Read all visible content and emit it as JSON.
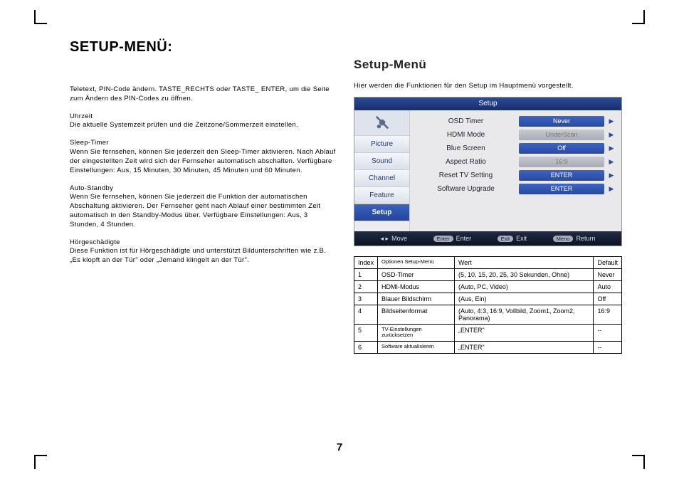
{
  "left": {
    "title": "SETUP-MENÜ:",
    "p1": "Teletext, PIN-Code ändern.\nTASTE_RECHTS oder TASTE_ ENTER, um die Seite zum Ändern des PIN-Codes zu öffnen.",
    "p2h": "Uhrzeit",
    "p2": "Die aktuelle Systemzeit prüfen und die Zeitzone/Sommerzeit einstellen.",
    "p3h": "Sleep-Timer",
    "p3": "Wenn Sie fernsehen, können Sie jederzeit den Sleep-Timer aktivieren. Nach Ablauf der eingestellten Zeit wird sich der Fernseher automatisch abschalten. Verfügbare Einstellungen: Aus, 15 Minuten, 30 Minuten, 45 Minuten und 60 Minuten.",
    "p4h": "Auto-Standby",
    "p4": "Wenn Sie fernsehen, können Sie jederzeit die Funktion der automatischen Abschaltung aktivieren. Der Fernseher geht nach Ablauf einer bestimmten Zeit automatisch in den Standby-Modus über. Verfügbare Einstellungen: Aus, 3 Stunden, 4 Stunden.",
    "p5h": "Hörgeschädigte",
    "p5": "Diese Funktion ist für Hörgeschädigte und unterstützt Bildunterschriften wie z.B. „Es klopft an der Tür\" oder „Jemand klingelt an der Tür\"."
  },
  "right": {
    "title": "Setup-Menü",
    "intro": "Hier werden die Funktionen für den Setup im Hauptmenü vorgestellt."
  },
  "osd": {
    "title": "Setup",
    "tabs": {
      "picture": "Picture",
      "sound": "Sound",
      "channel": "Channel",
      "feature": "Feature",
      "setup": "Setup"
    },
    "rows": [
      {
        "label": "OSD Timer",
        "val": "Never",
        "disabled": false
      },
      {
        "label": "HDMI Mode",
        "val": "UnderScan",
        "disabled": true
      },
      {
        "label": "Blue Screen",
        "val": "Off",
        "disabled": false
      },
      {
        "label": "Aspect Ratio",
        "val": "16:9",
        "disabled": true
      },
      {
        "label": "Reset TV Setting",
        "val": "ENTER",
        "disabled": false
      },
      {
        "label": "Software Upgrade",
        "val": "ENTER",
        "disabled": false
      }
    ],
    "foot": {
      "move": "Move",
      "enter": "Enter",
      "exit": "Exit",
      "return": "Return",
      "enterKey": "Enter",
      "exitKey": "Exit",
      "menuKey": "Menu"
    }
  },
  "table": {
    "head": {
      "c1": "Index",
      "c2": "Optionen Setup-Menü",
      "c3": "Wert",
      "c4": "Default"
    },
    "rows": [
      {
        "i": "1",
        "opt": "OSD-Timer",
        "val": "(5, 10, 15, 20, 25, 30 Sekunden, Ohne)",
        "def": "Never"
      },
      {
        "i": "2",
        "opt": "HDMI-Modus",
        "val": "(Auto, PC, Video)",
        "def": "Auto"
      },
      {
        "i": "3",
        "opt": "Blauer Bildschirm",
        "val": "(Aus, Ein)",
        "def": "Off"
      },
      {
        "i": "4",
        "opt": "Bildseitenformat",
        "val": "(Auto, 4:3, 16:9, Vollbild, Zoom1, Zoom2, Panorama)",
        "def": "16:9"
      },
      {
        "i": "5",
        "opt": "TV-Einstellungen zurücksetzen",
        "small": true,
        "val": "„ENTER\"",
        "def": "--"
      },
      {
        "i": "6",
        "opt": "Software aktualisieren",
        "small": true,
        "val": "„ENTER\"",
        "def": "--"
      }
    ]
  },
  "pageNumber": "7"
}
